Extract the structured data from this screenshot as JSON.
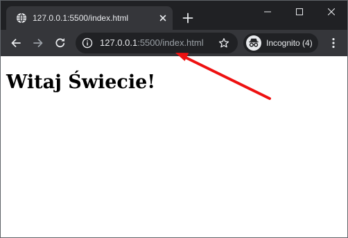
{
  "tab": {
    "title": "127.0.0.1:5500/index.html",
    "favicon": "globe-icon"
  },
  "address_bar": {
    "host": "127.0.0.1",
    "rest": ":5500/index.html"
  },
  "profile": {
    "label": "Incognito (4)",
    "icon": "incognito-icon"
  },
  "page": {
    "heading": "Witaj Świecie!"
  },
  "colors": {
    "tabstrip": "#202124",
    "toolbar": "#35363a",
    "omnibox": "#202124",
    "text_primary": "#e8eaed",
    "text_dim": "#9aa0a6",
    "annotation_arrow": "#ee1111"
  }
}
